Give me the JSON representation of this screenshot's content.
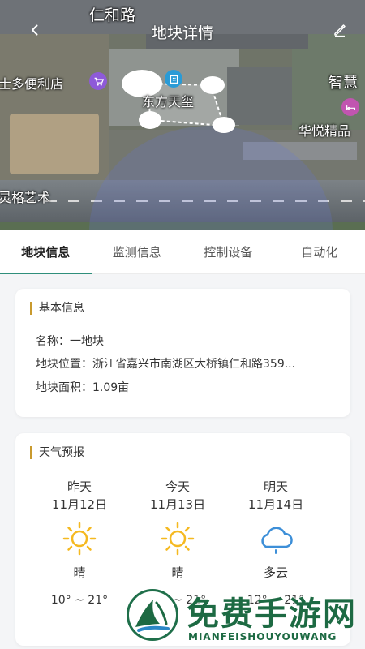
{
  "header": {
    "title": "地块详情"
  },
  "map": {
    "labels": {
      "road_top": "仁和路",
      "store_left": "士多便利店",
      "building_center": "东方天玺",
      "right_top": "智慧",
      "right_mid": "华悦精品",
      "left_bottom": "灵格艺术"
    }
  },
  "tabs": [
    {
      "label": "地块信息",
      "active": true
    },
    {
      "label": "监测信息",
      "active": false
    },
    {
      "label": "控制设备",
      "active": false
    },
    {
      "label": "自动化",
      "active": false
    }
  ],
  "basic_info": {
    "title": "基本信息",
    "name_line": "名称：一地块",
    "location_line": "地块位置：浙江省嘉兴市南湖区大桥镇仁和路359...",
    "area_line": "地块面积：1.09亩"
  },
  "weather": {
    "title": "天气预报",
    "days": [
      {
        "day": "昨天",
        "date": "11月12日",
        "icon": "sun-icon",
        "cond": "晴",
        "temp": "10° ~ 21°"
      },
      {
        "day": "今天",
        "date": "11月13日",
        "icon": "sun-icon",
        "cond": "晴",
        "temp": "11° ~ 21°"
      },
      {
        "day": "明天",
        "date": "11月14日",
        "icon": "cloud-icon",
        "cond": "多云",
        "temp": "12° ~ 21°"
      }
    ]
  },
  "watermark": {
    "text": "免费手游网",
    "sub": "MIANFEISHOUYOUWANG"
  },
  "colors": {
    "accent": "#2f8f7b",
    "title_bar": "#c99a2e",
    "sun": "#f5b921",
    "cloud": "#3d8fd8",
    "watermark": "#1d6a43"
  }
}
